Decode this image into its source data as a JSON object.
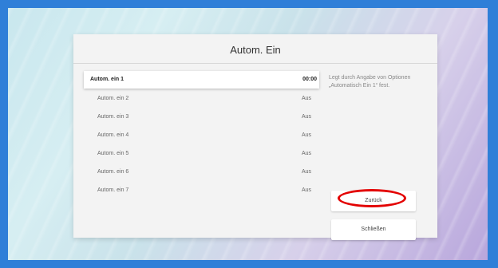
{
  "dialog": {
    "title": "Autom. Ein",
    "description": "Legt durch Angabe von Optionen „Automatisch Ein 1“ fest."
  },
  "items": [
    {
      "label": "Autom. ein 1",
      "value": "00:00",
      "selected": true
    },
    {
      "label": "Autom. ein 2",
      "value": "Aus",
      "selected": false
    },
    {
      "label": "Autom. ein 3",
      "value": "Aus",
      "selected": false
    },
    {
      "label": "Autom. ein 4",
      "value": "Aus",
      "selected": false
    },
    {
      "label": "Autom. ein 5",
      "value": "Aus",
      "selected": false
    },
    {
      "label": "Autom. ein 6",
      "value": "Aus",
      "selected": false
    },
    {
      "label": "Autom. ein 7",
      "value": "Aus",
      "selected": false
    }
  ],
  "buttons": {
    "back_label": "Zurück",
    "close_label": "Schließen"
  },
  "colors": {
    "frame": "#2f7fd8",
    "highlight": "#e30000"
  }
}
